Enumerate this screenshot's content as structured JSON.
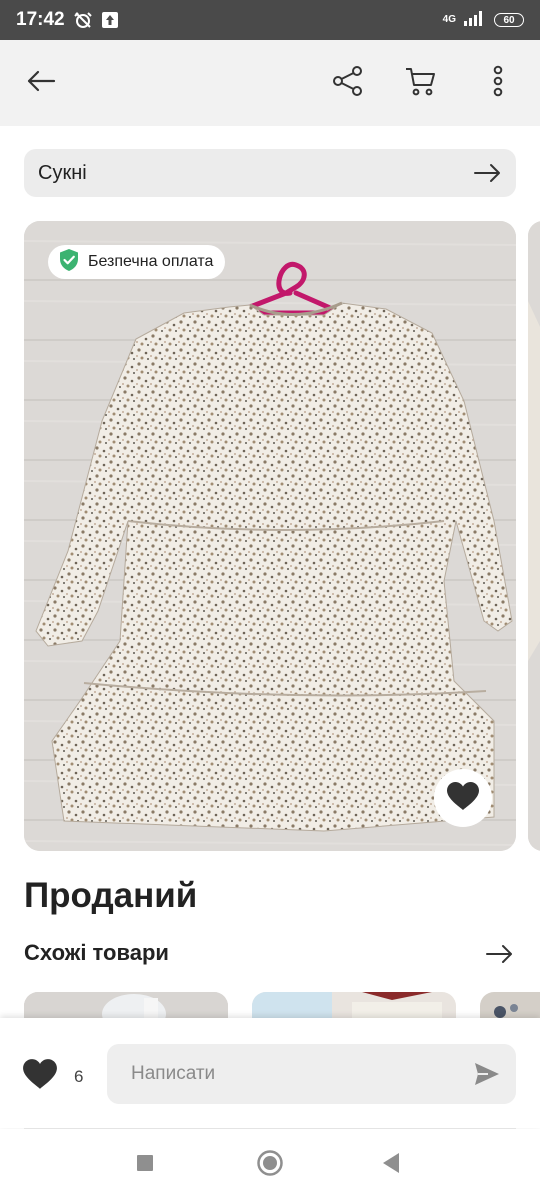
{
  "status_bar": {
    "time": "17:42",
    "network": "4G",
    "battery": "60"
  },
  "app_bar": {
    "icons": [
      "back-arrow-icon",
      "share-icon",
      "cart-icon",
      "more-vertical-icon"
    ]
  },
  "category": {
    "label": "Сукні"
  },
  "listing": {
    "badge_text": "Безпечна оплата",
    "status_title": "Проданий",
    "photo_subject": "dress-photo"
  },
  "similar": {
    "title": "Схожі товари"
  },
  "bottom_bar": {
    "likes_count": "6",
    "message_placeholder": "Написати"
  },
  "colors": {
    "accent_green": "#3cb371",
    "hanger_magenta": "#c2186b",
    "chip_bg": "#ececec",
    "appbar_bg": "#f2f2f2"
  }
}
